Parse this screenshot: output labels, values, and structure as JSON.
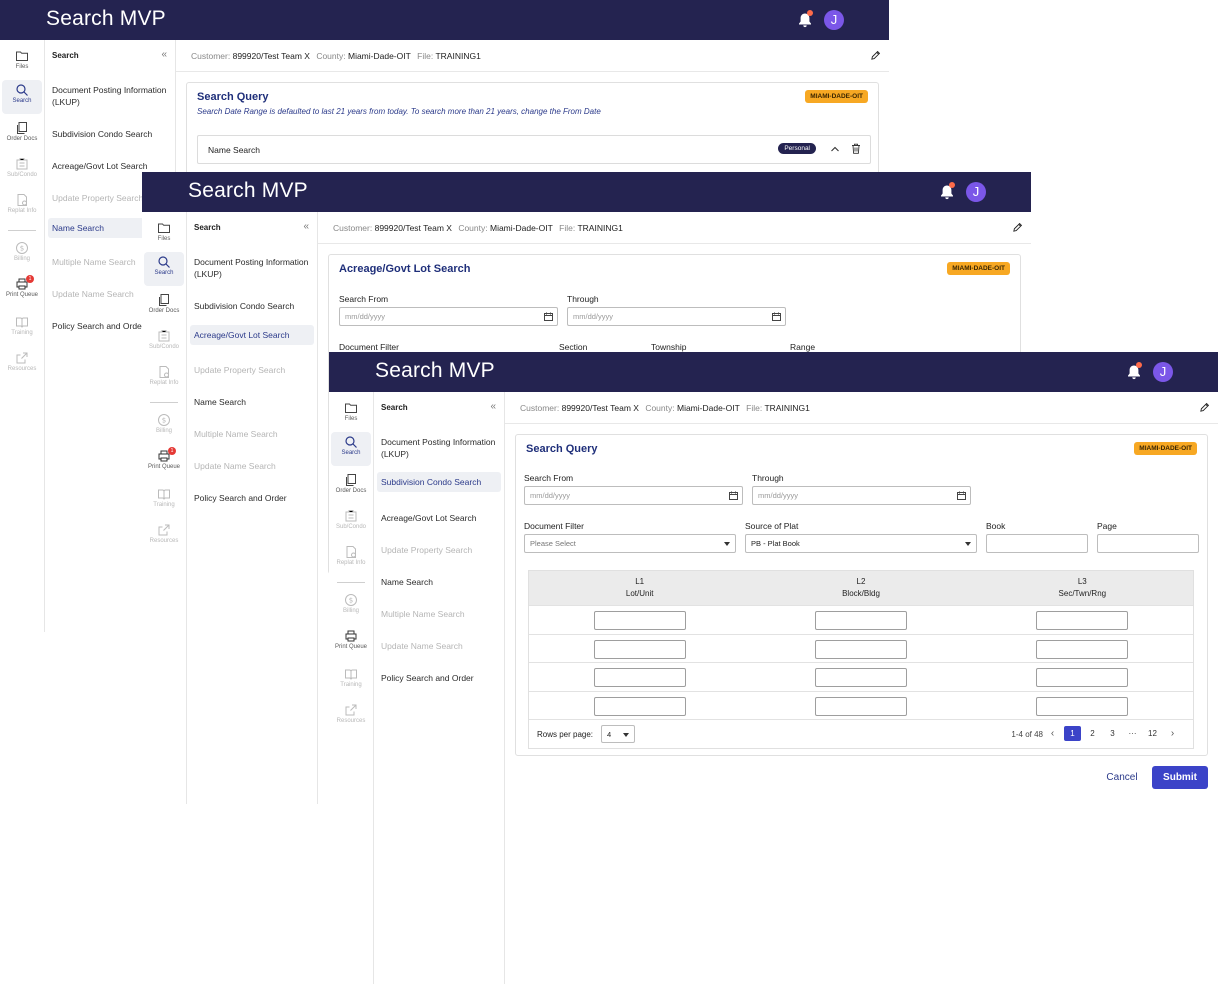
{
  "app": {
    "title": "Search MVP",
    "avatar_initial": "J"
  },
  "info": {
    "customer_label": "Customer:",
    "customer_value": "899920/Test Team X",
    "county_label": "County:",
    "county_value": "Miami-Dade-OIT",
    "file_label": "File:",
    "file_value": "TRAINING1"
  },
  "rail": {
    "files": "Files",
    "search": "Search",
    "order_docs": "Order Docs",
    "sub_condo": "Sub/Condo",
    "replat_info": "Replat Info",
    "billing": "Billing",
    "print_queue": "Print Queue",
    "print_badge": "1",
    "training": "Training",
    "resources": "Resources"
  },
  "nav": {
    "title": "Search",
    "items": [
      "Document Posting Information (LKUP)",
      "Subdivision Condo Search",
      "Acreage/Govt Lot Search",
      "Update Property Search",
      "Name Search",
      "Multiple Name Search",
      "Update Name Search",
      "Policy Search and Order"
    ]
  },
  "badge": "MIAMI-DADE-OIT",
  "window1": {
    "card_title": "Search Query",
    "hint": "Search Date Range is defaulted to last 21 years from today. To search more than 21 years, change the From Date",
    "name_search_label": "Name Search",
    "pill": "Personal"
  },
  "window2": {
    "card_title": "Acreage/Govt Lot Search",
    "search_from": "Search From",
    "through": "Through",
    "date_placeholder": "mm/dd/yyyy",
    "document_filter": "Document Filter",
    "section": "Section",
    "township": "Township",
    "range": "Range"
  },
  "window3": {
    "card_title": "Search Query",
    "search_from": "Search From",
    "through": "Through",
    "date_placeholder": "mm/dd/yyyy",
    "document_filter": "Document Filter",
    "document_filter_value": "Please Select",
    "source_of_plat": "Source of Plat",
    "source_of_plat_value": "PB - Plat Book",
    "book": "Book",
    "page": "Page",
    "columns": [
      {
        "line1": "L1",
        "line2": "Lot/Unit"
      },
      {
        "line1": "L2",
        "line2": "Block/Bldg"
      },
      {
        "line1": "L3",
        "line2": "Sec/Twn/Rng"
      }
    ],
    "rows_per_page_label": "Rows per page:",
    "rows_per_page_value": "4",
    "range_text": "1-4 of 48",
    "pages": [
      "1",
      "2",
      "3",
      "···",
      "12"
    ],
    "cancel": "Cancel",
    "submit": "Submit"
  },
  "colors": {
    "topbar": "#242350",
    "accent": "#3b43c8",
    "badge": "#f7a823",
    "avatar": "#7b57e8"
  }
}
